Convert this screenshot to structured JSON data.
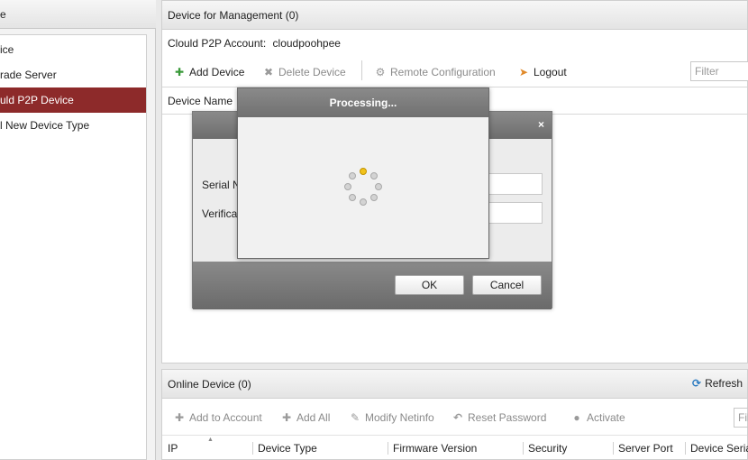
{
  "sidebar": {
    "header_text": "e",
    "items": [
      {
        "label": "ice"
      },
      {
        "label": "rade Server"
      },
      {
        "label": "uld P2P Device"
      },
      {
        "label": "l New Device Type"
      }
    ]
  },
  "main": {
    "title": "Device for Management (0)",
    "account_label": "Clould P2P Account:",
    "account_value": "cloudpoohpee",
    "toolbar": {
      "add_device": "Add Device",
      "delete_device": "Delete Device",
      "remote_config": "Remote Configuration",
      "logout": "Logout"
    },
    "filter_placeholder": "Filter",
    "columns": [
      "Device Name"
    ]
  },
  "online": {
    "title": "Online Device (0)",
    "refresh": "Refresh",
    "toolbar": {
      "add_to_account": "Add to Account",
      "add_all": "Add All",
      "modify_netinfo": "Modify Netinfo",
      "reset_password": "Reset Password",
      "activate": "Activate"
    },
    "filter_placeholder": "Filt",
    "columns": [
      "IP",
      "Device Type",
      "Firmware Version",
      "Security",
      "Server Port",
      "Device Serial"
    ]
  },
  "dialog": {
    "close": "×",
    "serial_label": "Serial N",
    "verification_label": "Verifica",
    "ok": "OK",
    "cancel": "Cancel"
  },
  "processing": {
    "title": "Processing..."
  },
  "colors": {
    "accent_active": "#8d2a2a",
    "spinner_active": "#f1c21b",
    "add_icon": "#3a9a3a",
    "logout_icon": "#e08a2a"
  }
}
